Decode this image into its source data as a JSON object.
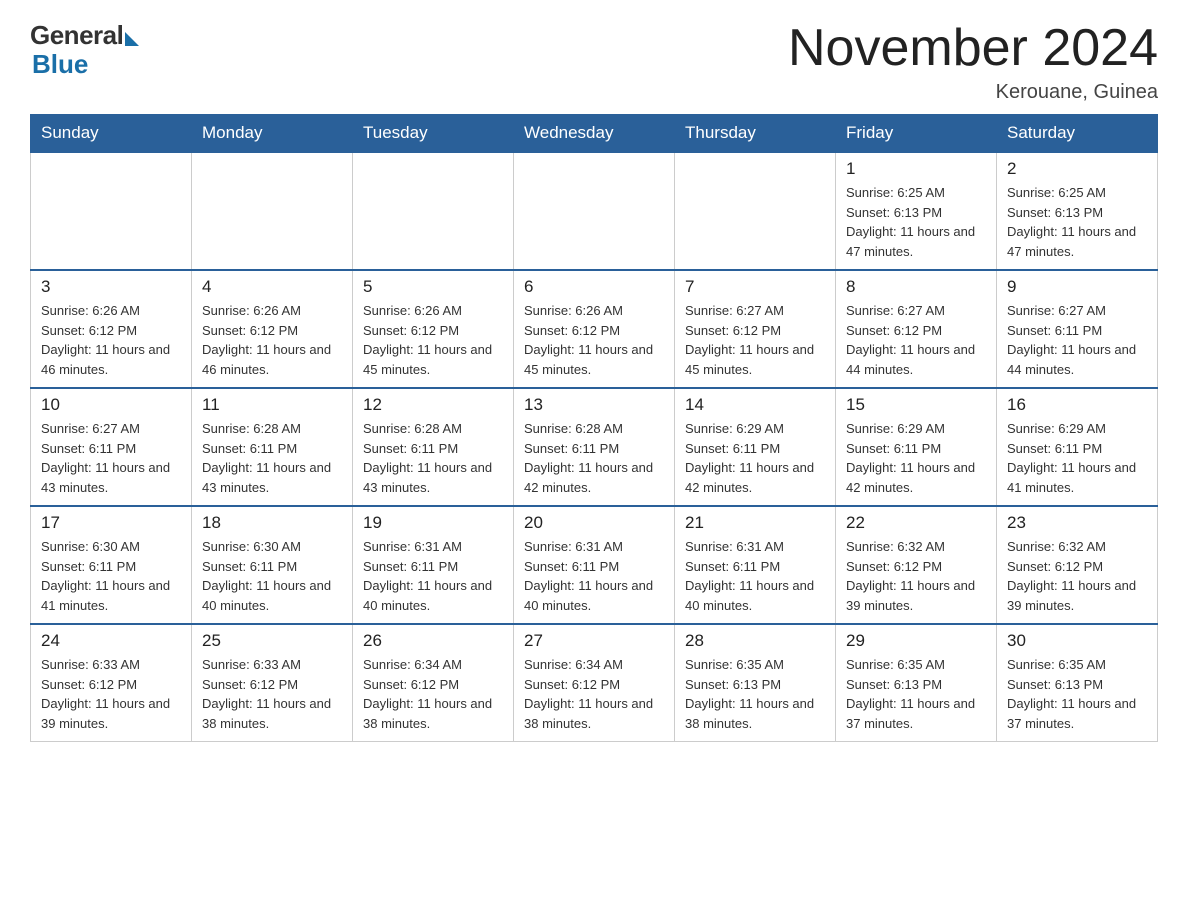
{
  "logo": {
    "general": "General",
    "blue": "Blue"
  },
  "title": "November 2024",
  "location": "Kerouane, Guinea",
  "days_of_week": [
    "Sunday",
    "Monday",
    "Tuesday",
    "Wednesday",
    "Thursday",
    "Friday",
    "Saturday"
  ],
  "weeks": [
    [
      {
        "day": "",
        "info": ""
      },
      {
        "day": "",
        "info": ""
      },
      {
        "day": "",
        "info": ""
      },
      {
        "day": "",
        "info": ""
      },
      {
        "day": "",
        "info": ""
      },
      {
        "day": "1",
        "info": "Sunrise: 6:25 AM\nSunset: 6:13 PM\nDaylight: 11 hours and 47 minutes."
      },
      {
        "day": "2",
        "info": "Sunrise: 6:25 AM\nSunset: 6:13 PM\nDaylight: 11 hours and 47 minutes."
      }
    ],
    [
      {
        "day": "3",
        "info": "Sunrise: 6:26 AM\nSunset: 6:12 PM\nDaylight: 11 hours and 46 minutes."
      },
      {
        "day": "4",
        "info": "Sunrise: 6:26 AM\nSunset: 6:12 PM\nDaylight: 11 hours and 46 minutes."
      },
      {
        "day": "5",
        "info": "Sunrise: 6:26 AM\nSunset: 6:12 PM\nDaylight: 11 hours and 45 minutes."
      },
      {
        "day": "6",
        "info": "Sunrise: 6:26 AM\nSunset: 6:12 PM\nDaylight: 11 hours and 45 minutes."
      },
      {
        "day": "7",
        "info": "Sunrise: 6:27 AM\nSunset: 6:12 PM\nDaylight: 11 hours and 45 minutes."
      },
      {
        "day": "8",
        "info": "Sunrise: 6:27 AM\nSunset: 6:12 PM\nDaylight: 11 hours and 44 minutes."
      },
      {
        "day": "9",
        "info": "Sunrise: 6:27 AM\nSunset: 6:11 PM\nDaylight: 11 hours and 44 minutes."
      }
    ],
    [
      {
        "day": "10",
        "info": "Sunrise: 6:27 AM\nSunset: 6:11 PM\nDaylight: 11 hours and 43 minutes."
      },
      {
        "day": "11",
        "info": "Sunrise: 6:28 AM\nSunset: 6:11 PM\nDaylight: 11 hours and 43 minutes."
      },
      {
        "day": "12",
        "info": "Sunrise: 6:28 AM\nSunset: 6:11 PM\nDaylight: 11 hours and 43 minutes."
      },
      {
        "day": "13",
        "info": "Sunrise: 6:28 AM\nSunset: 6:11 PM\nDaylight: 11 hours and 42 minutes."
      },
      {
        "day": "14",
        "info": "Sunrise: 6:29 AM\nSunset: 6:11 PM\nDaylight: 11 hours and 42 minutes."
      },
      {
        "day": "15",
        "info": "Sunrise: 6:29 AM\nSunset: 6:11 PM\nDaylight: 11 hours and 42 minutes."
      },
      {
        "day": "16",
        "info": "Sunrise: 6:29 AM\nSunset: 6:11 PM\nDaylight: 11 hours and 41 minutes."
      }
    ],
    [
      {
        "day": "17",
        "info": "Sunrise: 6:30 AM\nSunset: 6:11 PM\nDaylight: 11 hours and 41 minutes."
      },
      {
        "day": "18",
        "info": "Sunrise: 6:30 AM\nSunset: 6:11 PM\nDaylight: 11 hours and 40 minutes."
      },
      {
        "day": "19",
        "info": "Sunrise: 6:31 AM\nSunset: 6:11 PM\nDaylight: 11 hours and 40 minutes."
      },
      {
        "day": "20",
        "info": "Sunrise: 6:31 AM\nSunset: 6:11 PM\nDaylight: 11 hours and 40 minutes."
      },
      {
        "day": "21",
        "info": "Sunrise: 6:31 AM\nSunset: 6:11 PM\nDaylight: 11 hours and 40 minutes."
      },
      {
        "day": "22",
        "info": "Sunrise: 6:32 AM\nSunset: 6:12 PM\nDaylight: 11 hours and 39 minutes."
      },
      {
        "day": "23",
        "info": "Sunrise: 6:32 AM\nSunset: 6:12 PM\nDaylight: 11 hours and 39 minutes."
      }
    ],
    [
      {
        "day": "24",
        "info": "Sunrise: 6:33 AM\nSunset: 6:12 PM\nDaylight: 11 hours and 39 minutes."
      },
      {
        "day": "25",
        "info": "Sunrise: 6:33 AM\nSunset: 6:12 PM\nDaylight: 11 hours and 38 minutes."
      },
      {
        "day": "26",
        "info": "Sunrise: 6:34 AM\nSunset: 6:12 PM\nDaylight: 11 hours and 38 minutes."
      },
      {
        "day": "27",
        "info": "Sunrise: 6:34 AM\nSunset: 6:12 PM\nDaylight: 11 hours and 38 minutes."
      },
      {
        "day": "28",
        "info": "Sunrise: 6:35 AM\nSunset: 6:13 PM\nDaylight: 11 hours and 38 minutes."
      },
      {
        "day": "29",
        "info": "Sunrise: 6:35 AM\nSunset: 6:13 PM\nDaylight: 11 hours and 37 minutes."
      },
      {
        "day": "30",
        "info": "Sunrise: 6:35 AM\nSunset: 6:13 PM\nDaylight: 11 hours and 37 minutes."
      }
    ]
  ]
}
